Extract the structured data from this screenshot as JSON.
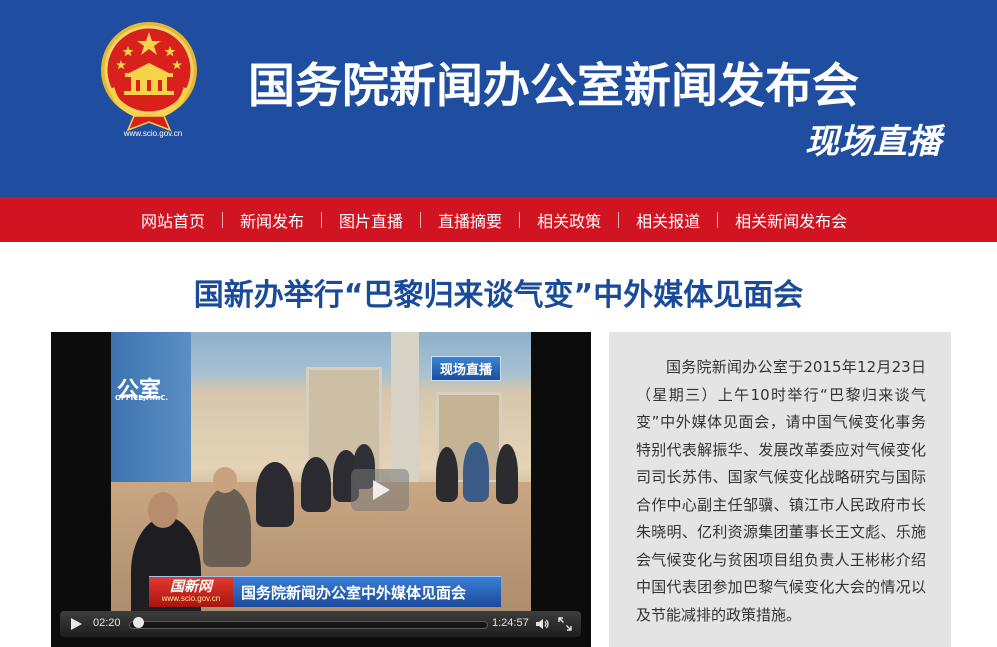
{
  "header": {
    "site_url": "www.scio.gov.cn",
    "title": "国务院新闻办公室新闻发布会",
    "live_label": "现场直播"
  },
  "nav": {
    "items": [
      "网站首页",
      "新闻发布",
      "图片直播",
      "直播摘要",
      "相关政策",
      "相关报道",
      "相关新闻发布会"
    ]
  },
  "article": {
    "headline": "国新办举行“巴黎归来谈气变”中外媒体见面会",
    "description": "国务院新闻办公室于2015年12月23日（星期三）上午10时举行“巴黎归来谈气变”中外媒体见面会，请中国气候变化事务特别代表解振华、发展改革委应对气候变化司司长苏伟、国家气候变化战略研究与国际合作中心副主任邹骥、镇江市人民政府市长朱晓明、亿利资源集团董事长王文彪、乐施会气候变化与贫困项目组负责人王彬彬介绍中国代表团参加巴黎气候变化大会的情况以及节能减排的政策措施。"
  },
  "video": {
    "live_badge": "现场直播",
    "wall_text": "公室",
    "wall_sub": "OFFICE,P.R.C.",
    "banner_logo": "国新网",
    "banner_url": "www.scio.gov.cn",
    "banner_text": "国务院新闻办公室中外媒体见面会",
    "current_time": "02:20",
    "duration": "1:24:57",
    "progress_fraction": 0.027
  },
  "colors": {
    "header_blue": "#1f4ea0",
    "nav_red": "#d11421",
    "headline_blue": "#1a4a9a",
    "desc_bg": "#e4e4e4"
  }
}
